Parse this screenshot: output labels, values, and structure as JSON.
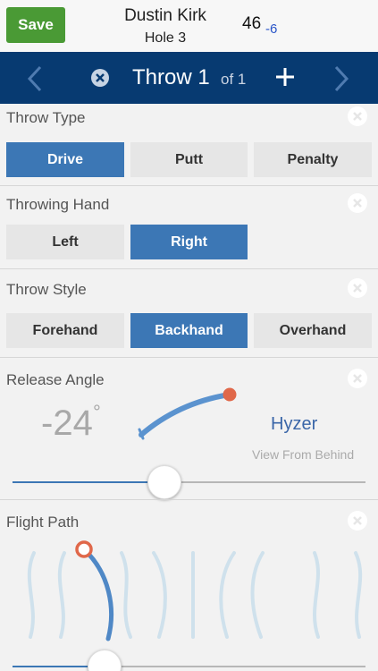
{
  "header": {
    "save_label": "Save",
    "player_name": "Dustin Kirk",
    "hole": "Hole 3",
    "score": "46",
    "score_relative": "-6"
  },
  "nav": {
    "throw_label": "Throw 1",
    "of_label": "of 1"
  },
  "throw_type": {
    "label": "Throw Type",
    "options": [
      "Drive",
      "Putt",
      "Penalty"
    ],
    "selected": "Drive"
  },
  "throwing_hand": {
    "label": "Throwing Hand",
    "options": [
      "Left",
      "Right"
    ],
    "selected": "Right"
  },
  "throw_style": {
    "label": "Throw Style",
    "options": [
      "Forehand",
      "Backhand",
      "Overhand"
    ],
    "selected": "Backhand"
  },
  "release_angle": {
    "label": "Release Angle",
    "value": "-24",
    "degree_symbol": "°",
    "description": "Hyzer",
    "view_note": "View From Behind",
    "slider_fraction": 0.43
  },
  "flight_path": {
    "label": "Flight Path",
    "slider_fraction": 0.26
  },
  "colors": {
    "accent": "#3c77b5",
    "nav_bg": "#073a71",
    "save_green": "#4a9a35",
    "marker_orange": "#e0684a"
  }
}
